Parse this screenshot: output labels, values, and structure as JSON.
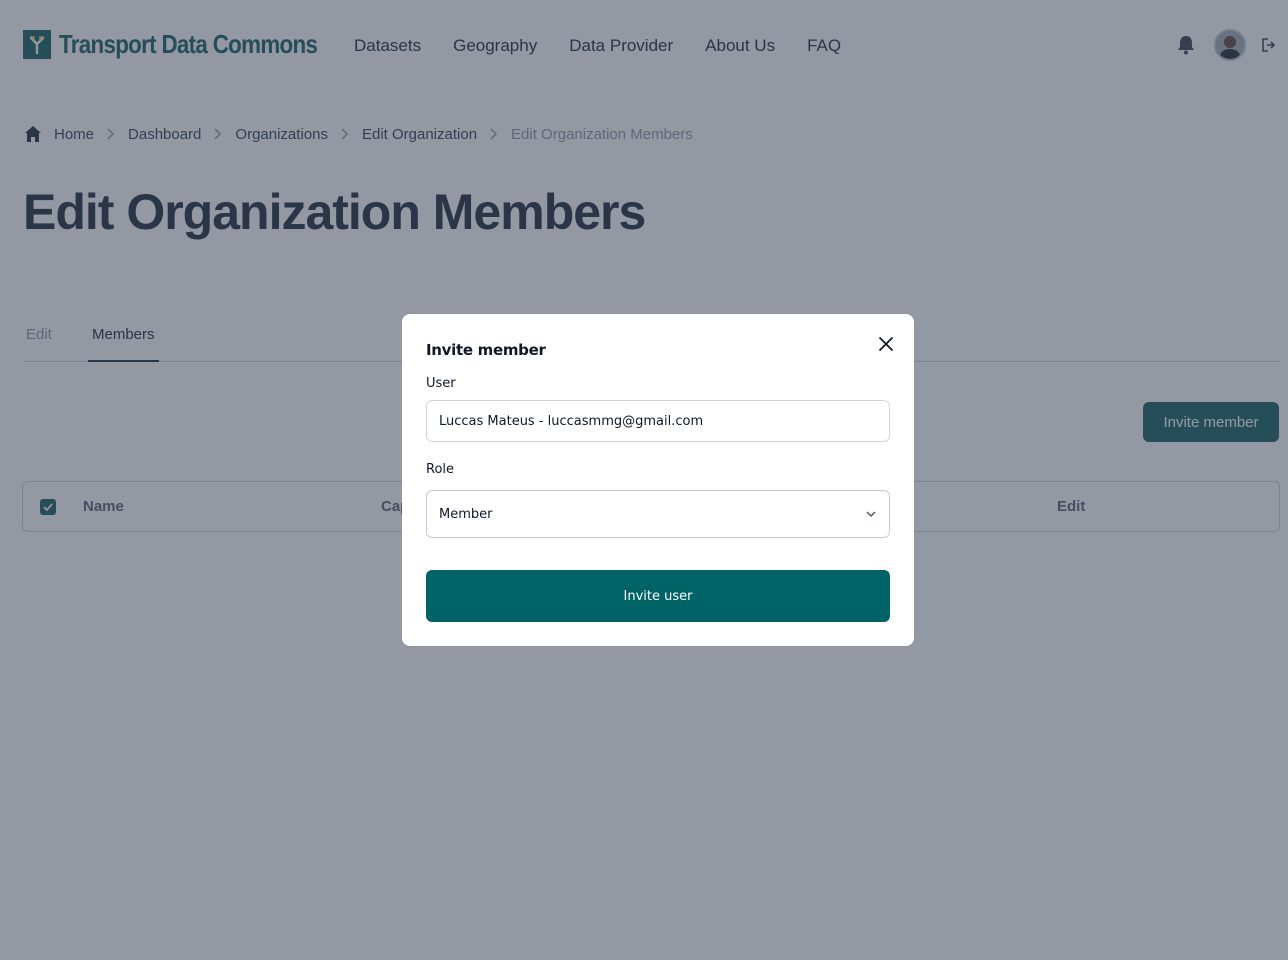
{
  "header": {
    "logo_text": "Transport Data Commons",
    "nav": [
      "Datasets",
      "Geography",
      "Data Provider",
      "About Us",
      "FAQ"
    ]
  },
  "breadcrumb": {
    "items": [
      "Home",
      "Dashboard",
      "Organizations",
      "Edit Organization",
      "Edit Organization Members"
    ]
  },
  "page": {
    "title": "Edit Organization Members",
    "tabs": [
      "Edit",
      "Members"
    ],
    "active_tab": "Members",
    "invite_button_label": "Invite member",
    "table_headers": [
      "Name",
      "Cap",
      "Edit"
    ]
  },
  "modal": {
    "title": "Invite member",
    "user_label": "User",
    "user_value": "Luccas Mateus - luccasmmg@gmail.com",
    "role_label": "Role",
    "role_value": "Member",
    "submit_label": "Invite user"
  },
  "colors": {
    "brand": "#2f6f73",
    "submit_button": "#006366",
    "overlay": "rgba(30,40,62,0.48)"
  }
}
